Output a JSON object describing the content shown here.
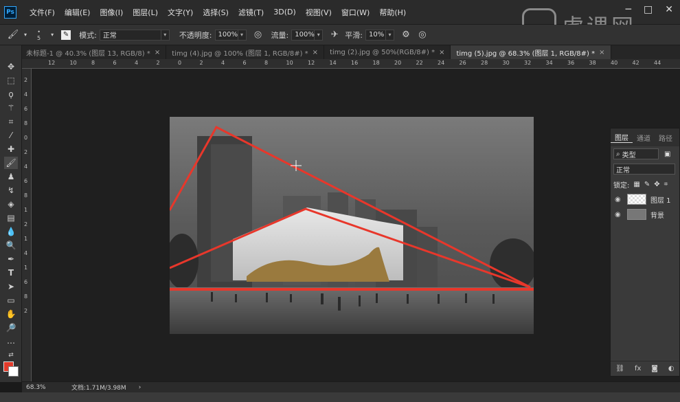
{
  "app": {
    "logo": "Ps",
    "menu": [
      "文件(F)",
      "编辑(E)",
      "图像(I)",
      "图层(L)",
      "文字(Y)",
      "选择(S)",
      "滤镜(T)",
      "3D(D)",
      "视图(V)",
      "窗口(W)",
      "帮助(H)"
    ],
    "watermark": "虎课网",
    "window_buttons": [
      "─",
      "□",
      "✕"
    ]
  },
  "options": {
    "brush_size": "5",
    "mode_label": "模式:",
    "mode_value": "正常",
    "opacity_label": "不透明度:",
    "opacity_value": "100%",
    "flow_label": "流量:",
    "flow_value": "100%",
    "smooth_label": "平滑:",
    "smooth_value": "10%"
  },
  "tabs": [
    {
      "label": "未标题-1 @ 40.3% (图层 13, RGB/8) *",
      "close": "×"
    },
    {
      "label": "timg (4).jpg @ 100% (图层 1, RGB/8#) *",
      "close": "×"
    },
    {
      "label": "timg (2).jpg @ 50%(RGB/8#) *",
      "close": "×"
    },
    {
      "label": "timg (5).jpg @ 68.3% (图层 1, RGB/8#) *",
      "close": "×"
    }
  ],
  "ruler_h": [
    "12",
    "10",
    "8",
    "6",
    "4",
    "2",
    "0",
    "2",
    "4",
    "6",
    "8",
    "10",
    "12",
    "14",
    "16",
    "18",
    "20",
    "22",
    "24",
    "26",
    "28",
    "30",
    "32",
    "34",
    "36",
    "38",
    "40",
    "42",
    "44"
  ],
  "ruler_v": [
    "2",
    "4",
    "6",
    "8",
    "0",
    "2",
    "4",
    "6",
    "8",
    "1",
    "2",
    "1",
    "4",
    "1",
    "6",
    "8",
    "2"
  ],
  "layers_panel": {
    "tabs": [
      "图层",
      "通道",
      "路径"
    ],
    "filter_label": "类型",
    "blend_mode": "正常",
    "lock_label": "锁定:",
    "layers": [
      {
        "name": "图层 1",
        "thumb": "transparent"
      },
      {
        "name": "背景",
        "thumb": "image"
      }
    ],
    "footer_icons": [
      "link-icon",
      "fx-icon",
      "mask-icon",
      "adjust-icon"
    ],
    "footer_fx": "fx"
  },
  "status": {
    "zoom": "68.3%",
    "doc_info": "文档:1.71M/3.98M"
  },
  "colors": {
    "foreground": "#e23a2a",
    "background": "#ffffff",
    "guide_line": "#e8372b"
  }
}
